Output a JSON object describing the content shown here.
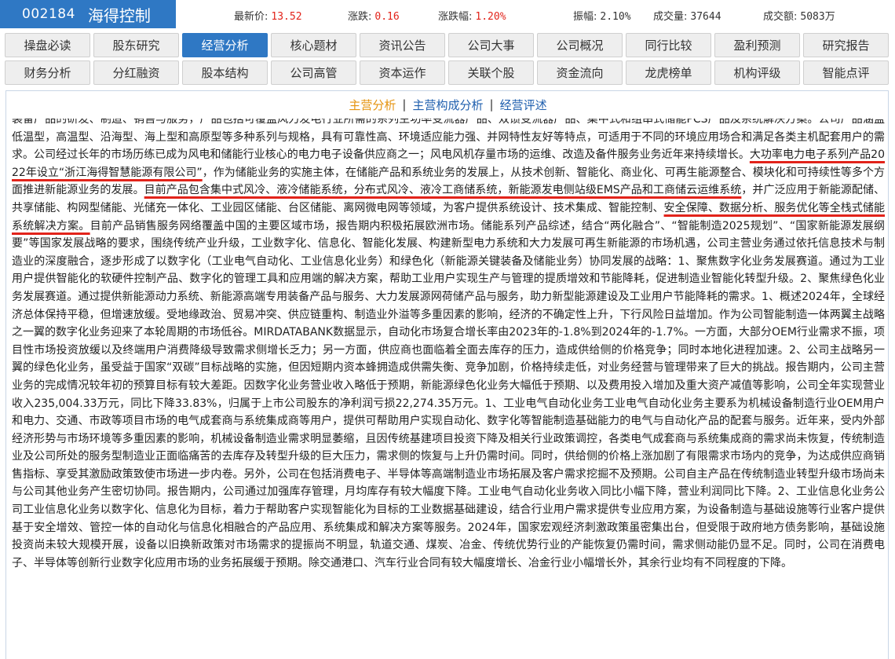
{
  "header": {
    "stock_code": "002184",
    "stock_name": "海得控制",
    "quotes": [
      {
        "label": "最新价:",
        "value": "13.52",
        "color": "#e2231a"
      },
      {
        "label": "涨跌:",
        "value": "0.16",
        "color": "#e2231a"
      },
      {
        "label": "涨跌幅:",
        "value": "1.20%",
        "color": "#e2231a"
      },
      {
        "label": "振幅:",
        "value": "2.10%",
        "color": "#333333"
      },
      {
        "label": "成交量:",
        "value": "37644",
        "color": "#333333"
      },
      {
        "label": "成交额:",
        "value": "5083万",
        "color": "#333333"
      }
    ]
  },
  "nav": {
    "row1": [
      "操盘必读",
      "股东研究",
      "经营分析",
      "核心题材",
      "资讯公告",
      "公司大事",
      "公司概况",
      "同行比较",
      "盈利预测",
      "研究报告"
    ],
    "row2": [
      "财务分析",
      "分红融资",
      "股本结构",
      "公司高管",
      "资本运作",
      "关联个股",
      "资金流向",
      "龙虎榜单",
      "机构评级",
      "智能点评"
    ],
    "active": "经营分析"
  },
  "subnav": {
    "items": [
      "主营分析",
      "主营构成分析",
      "经营评述"
    ],
    "separator": "|",
    "active": "主营分析"
  },
  "content": {
    "p1": "装备产品的研发、制造、销售与服务，产品包括可覆盖风力发电行业所需的系列主功率变流器产品、双馈变流器产品、集中式和组串式储能PCS产品及系统解决方案。公司产品涵盖低温型，高温型、沿海型、海上型和高原型等多种系列与规格，具有可靠性高、环境适应能力强、并网特性友好等特点，可适用于不同的环境应用场合和满足各类主机配套用户的需求。公司经过长年的市场历练已成为风电和储能行业核心的电力电子设备供应商之一；风电风机存量市场的运维、改造及备件服务业务近年来持续增长。",
    "h1": "大功率电力电子系列产品2022年设立“浙江海得智慧能源有限公司”",
    "p2": "，作为储能业务的实施主体，在储能产品和系统业务的发展上，从技术创新、智能化、商业化、可再生能源整合、模块化和可持续性等多个方面推进新能源业务的发展。",
    "h2": "目前产品包含集中式风冷、液冷储能系统，分布式风冷、液冷工商储系统，新能源发电侧站级EMS产品和工商储云运维系统",
    "p3": "，并广泛应用于新能源配储、共享储能、构网型储能、光储充一体化、工业园区储能、台区储能、离网微电网等领域，为客户提供系统设计、技术集成、智能控制、",
    "h3": "安全保障、数据分析、服务优化等全栈式储能系统解决方案。",
    "p4": "目前产品销售服务网络覆盖中国的主要区域市场，报告期内积极拓展欧洲市场。储能系列产品综述，结合“两化融合”、“智能制造2025规划”、“国家新能源发展纲要”等国家发展战略的要求，围绕传统产业升级，工业数字化、信息化、智能化发展、构建新型电力系统和大力发展可再生新能源的市场机遇，公司主营业务通过依托信息技术与制造业的深度融合，逐步形成了以数字化（工业电气自动化、工业信息化业务）和绿色化（新能源关键装备及储能业务）协同发展的战略：1、聚焦数字化业务发展赛道。通过为工业用户提供智能化的软硬件控制产品、数字化的管理工具和应用端的解决方案，帮助工业用户实现生产与管理的提质增效和节能降耗，促进制造业智能化转型升级。2、聚焦绿色化业务发展赛道。通过提供新能源动力系统、新能源高端专用装备产品与服务、大力发展源网荷储产品与服务，助力新型能源建设及工业用户节能降耗的需求。1、概述2024年，全球经济总体保持平稳，但增速放缓。受地缘政治、贸易冲突、供应链重构、制造业外溢等多重因素的影响，经济的不确定性上升，下行风险日益增加。作为公司智能制造一体两翼主战略之一翼的数字化业务迎来了本轮周期的市场低谷。MIRDATABANK数据显示，自动化市场复合增长率由2023年的-1.8%到2024年的-1.7%。一方面，大部分OEM行业需求不振，项目性市场投资放缓以及终端用户消费降级导致需求侧增长乏力；另一方面，供应商也面临着全面去库存的压力，造成供给侧的价格竞争；同时本地化进程加速。2、公司主战略另一翼的绿色化业务，虽受益于国家“双碳”目标战略的实施，但因短期内资本蜂拥造成供需失衡、竞争加剧，价格持续走低，对业务经营与管理带来了巨大的挑战。报告期内，公司主营业务的完成情况较年初的预算目标有较大差距。因数字化业务营业收入略低于预期，新能源绿色化业务大幅低于预期、以及费用投入增加及重大资产减值等影响，公司全年实现营业收入235,004.33万元，同比下降33.83%，归属于上市公司股东的净利润亏损22,274.35万元。1、工业电气自动化业务工业电气自动化业务主要系为机械设备制造行业OEM用户和电力、交通、市政等项目市场的电气成套商与系统集成商等用户，提供可帮助用户实现自动化、数字化等智能制造基础能力的电气与自动化产品的配套与服务。近年来，受内外部经济形势与市场环境等多重因素的影响，机械设备制造业需求明显萎缩，且因传统基建项目投资下降及相关行业政策调控，各类电气成套商与系统集成商的需求尚未恢复，传统制造业及公司所处的服务型制造业正面临痛苦的去库存及转型升级的巨大压力，需求侧的恢复与上升仍需时间。同时，供给侧的价格上涨加剧了有限需求市场内的竞争，为达成供应商销售指标、享受其激励政策致使市场进一步内卷。另外，公司在包括消费电子、半导体等高端制造业市场拓展及客户需求挖掘不及预期。公司自主产品在传统制造业转型升级市场尚未与公司其他业务产生密切协同。报告期内，公司通过加强库存管理，月均库存有较大幅度下降。工业电气自动化业务收入同比小幅下降，营业利润同比下降。2、工业信息化业务公司工业信息化业务以数字化、信息化为目标，着力于帮助客户实现智能化为目标的工业数据基础建设，结合行业用户需求提供专业应用方案，为设备制造与基础设施等行业客户提供基于安全增效、管控一体的自动化与信息化相融合的产品应用、系统集成和解决方案等服务。2024年，国家宏观经济刺激政策虽密集出台，但受限于政府地方债务影响，基础设施投资尚未较大规模开展，设备以旧换新政策对市场需求的提振尚不明显，轨道交通、煤炭、冶金、传统优势行业的产能恢复仍需时间，需求侧动能仍显不足。同时，公司在消费电子、半导体等创新行业数字化应用市场的业务拓展缓于预期。除交通港口、汽车行业合同有较大幅度增长、冶金行业小幅增长外，其余行业均有不同程度的下降。"
  },
  "colors": {
    "brand_blue": "#2f78c4",
    "price_red": "#e2231a",
    "subnav_active": "#e5930f",
    "subnav_link": "#1f5fae",
    "highlight_underline": "#e2231a"
  }
}
